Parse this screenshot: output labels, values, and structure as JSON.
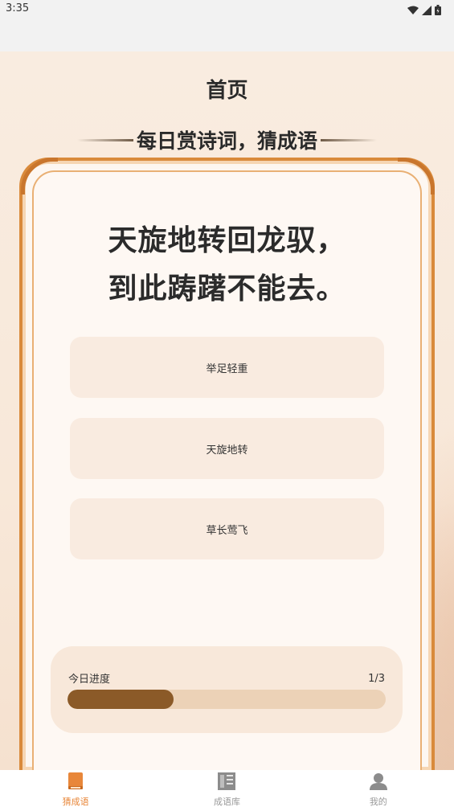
{
  "status_bar": {
    "time": "3:35",
    "icons": [
      "wifi-icon",
      "signal-icon",
      "battery-icon"
    ]
  },
  "page": {
    "title": "首页",
    "subtitle": "每日赏诗词，猜成语"
  },
  "question": {
    "line1": "天旋地转回龙驭，",
    "line2": "到此踌躇不能去。"
  },
  "options": [
    {
      "label": "举足轻重"
    },
    {
      "label": "天旋地转"
    },
    {
      "label": "草长莺飞"
    }
  ],
  "progress": {
    "label": "今日进度",
    "count_text": "1/3",
    "fraction": 0.3333
  },
  "nav": {
    "items": [
      {
        "label": "猜成语",
        "icon": "book-icon",
        "active": true
      },
      {
        "label": "成语库",
        "icon": "idiom-library-icon",
        "active": false
      },
      {
        "label": "我的",
        "icon": "user-icon",
        "active": false
      }
    ]
  },
  "colors": {
    "accent": "#e8873a",
    "frame": "#d98a3b",
    "progress_fill": "#8b5a28",
    "option_bg": "#f9ebe0"
  }
}
